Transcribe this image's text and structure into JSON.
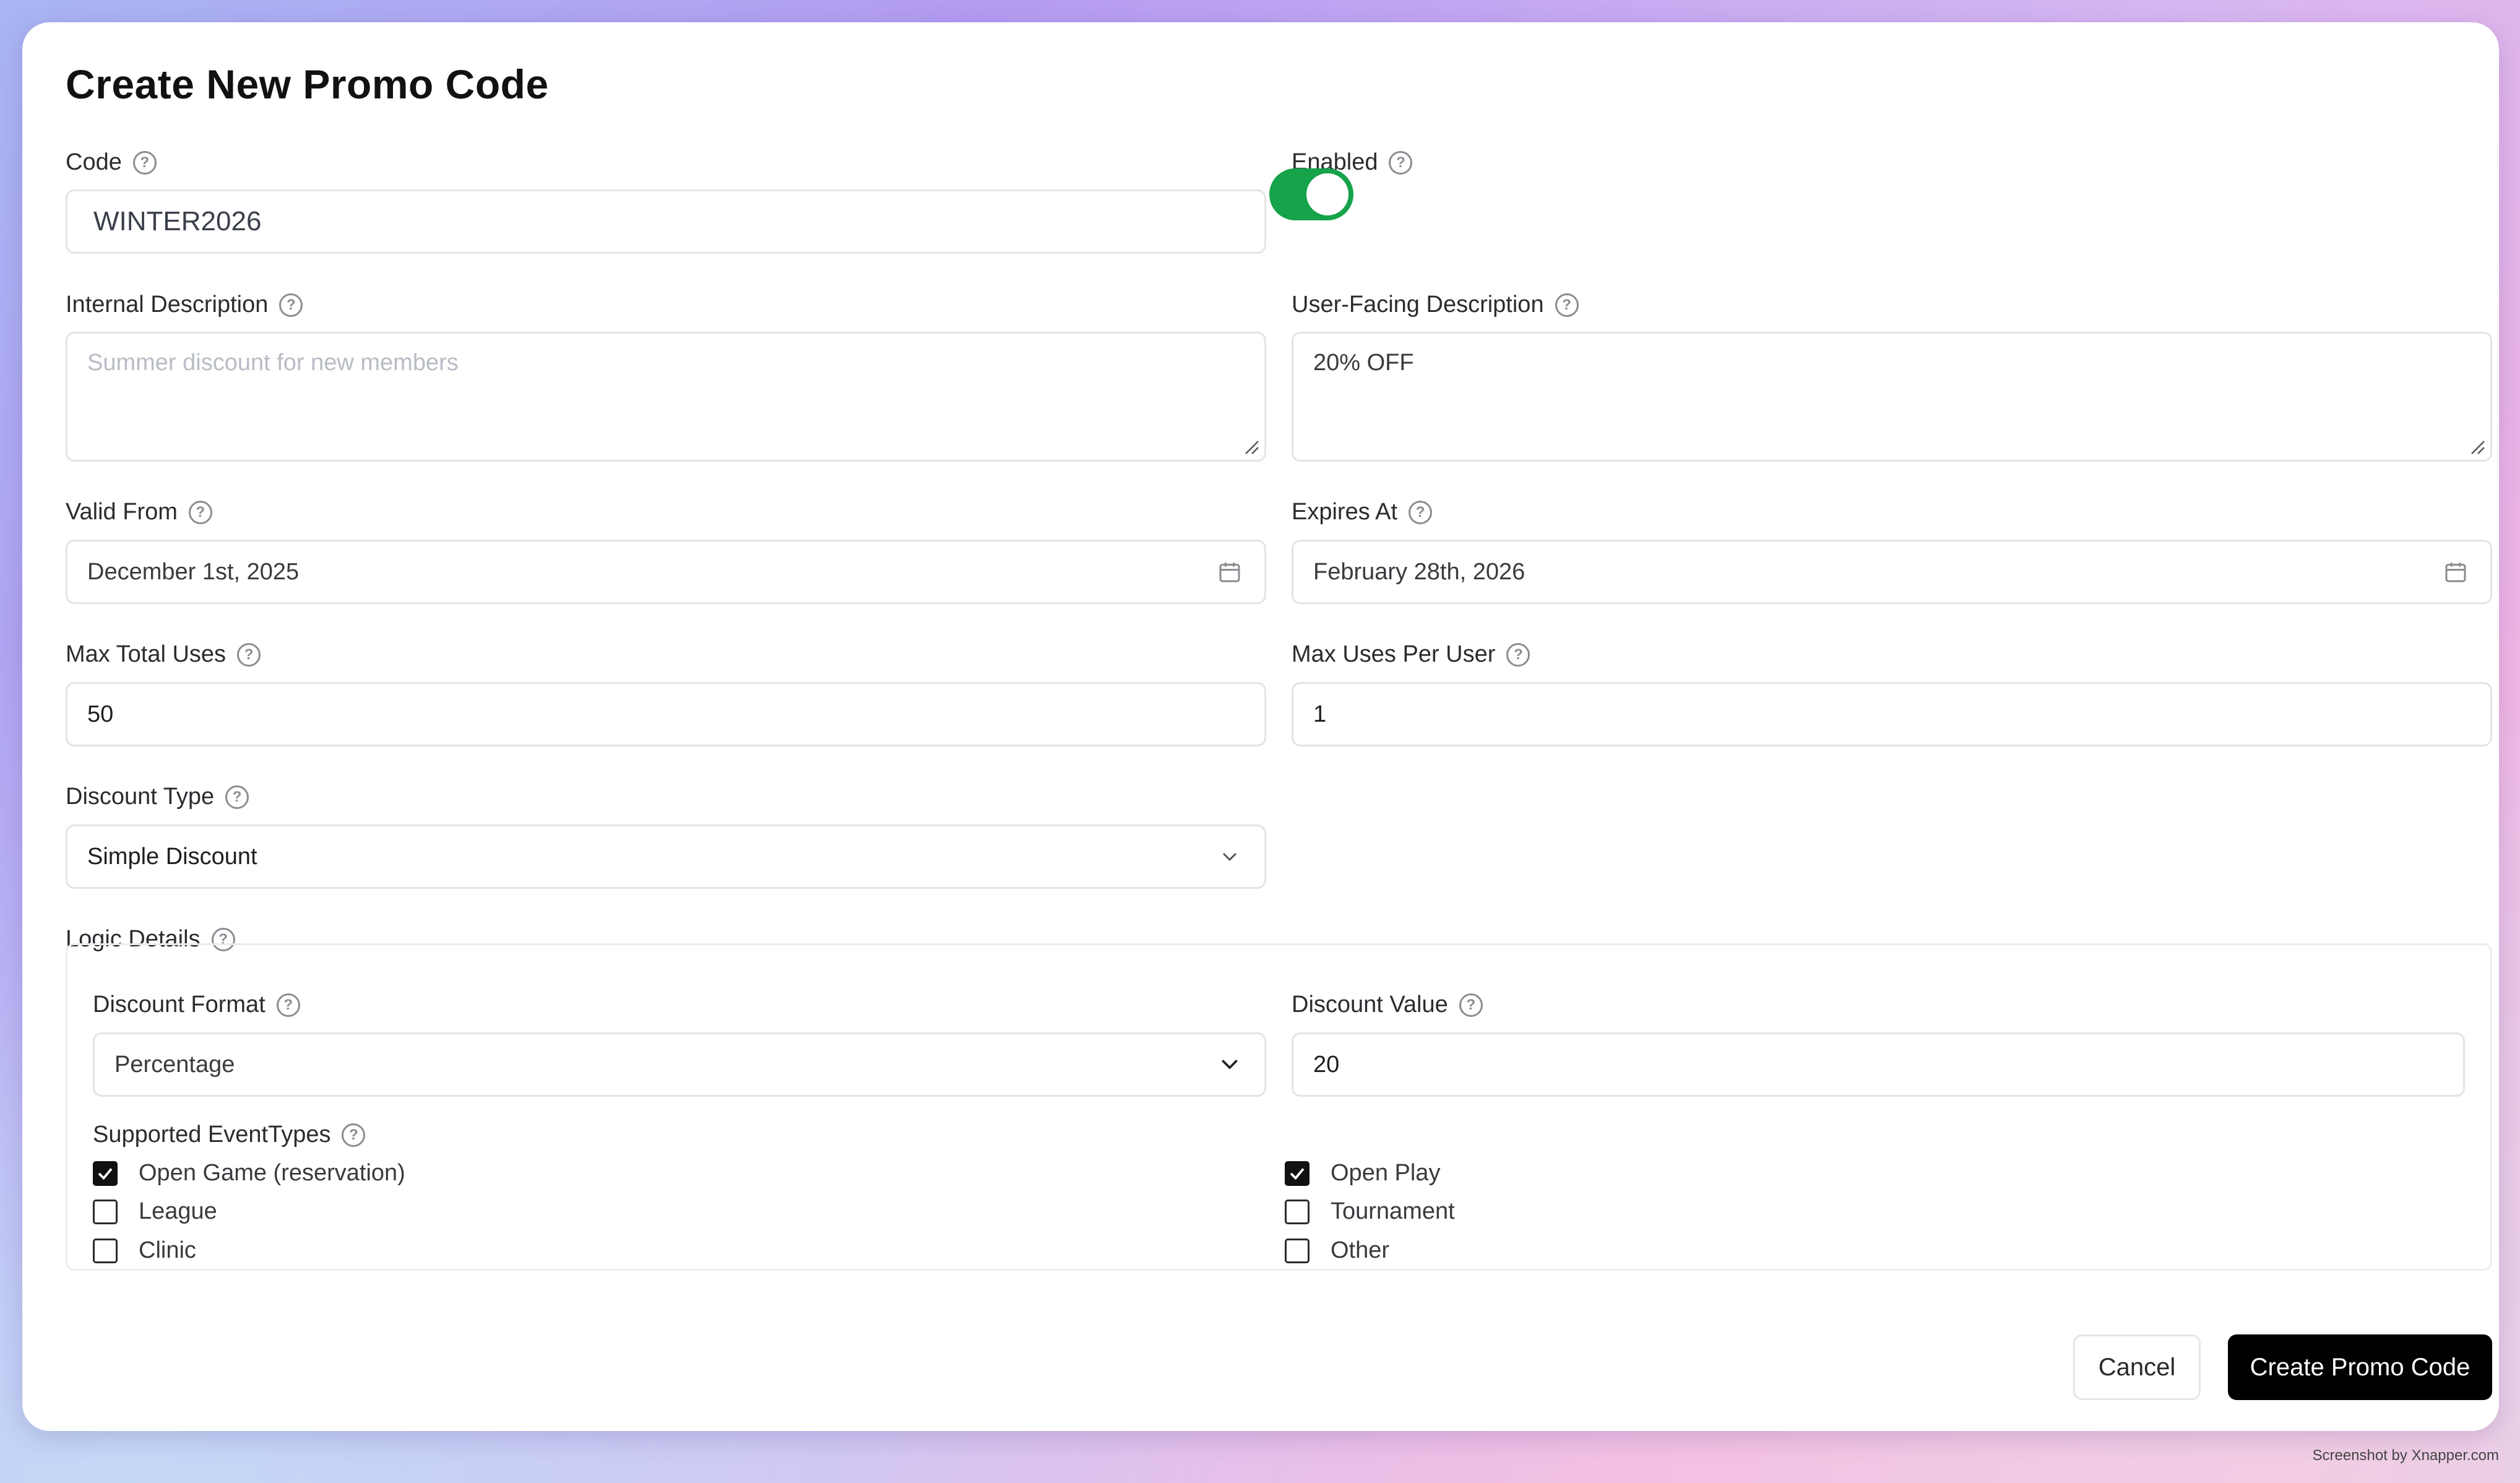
{
  "dialog": {
    "title": "Create New Promo Code"
  },
  "fields": {
    "code": {
      "label": "Code",
      "value": "WINTER2026"
    },
    "enabled": {
      "label": "Enabled",
      "on": true
    },
    "internal_description": {
      "label": "Internal Description",
      "placeholder": "Summer discount for new members",
      "value": ""
    },
    "user_description": {
      "label": "User-Facing Description",
      "value": "20% OFF"
    },
    "valid_from": {
      "label": "Valid From",
      "value": "December 1st, 2025",
      "icon": "calendar-icon"
    },
    "expires_at": {
      "label": "Expires At",
      "value": "February 28th, 2026",
      "icon": "calendar-icon"
    },
    "max_total_uses": {
      "label": "Max Total Uses",
      "value": "50"
    },
    "max_uses_per_user": {
      "label": "Max Uses Per User",
      "value": "1"
    },
    "discount_type": {
      "label": "Discount Type",
      "value": "Simple Discount",
      "icon": "chevron-down-icon"
    }
  },
  "logic": {
    "label": "Logic Details",
    "discount_format": {
      "label": "Discount Format",
      "value": "Percentage",
      "icon": "chevron-down-icon"
    },
    "discount_value": {
      "label": "Discount Value",
      "value": "20"
    },
    "event_types": {
      "label": "Supported EventTypes",
      "items": [
        {
          "label": "Open Game (reservation)",
          "checked": true
        },
        {
          "label": "League",
          "checked": false
        },
        {
          "label": "Clinic",
          "checked": false
        },
        {
          "label": "Open Play",
          "checked": true
        },
        {
          "label": "Tournament",
          "checked": false
        },
        {
          "label": "Other",
          "checked": false
        }
      ]
    }
  },
  "actions": {
    "cancel_label": "Cancel",
    "create_label": "Create Promo Code"
  },
  "watermark": "Screenshot by Xnapper.com",
  "colors": {
    "toggle_on": "#16a34a",
    "primary_button": "#000000"
  }
}
